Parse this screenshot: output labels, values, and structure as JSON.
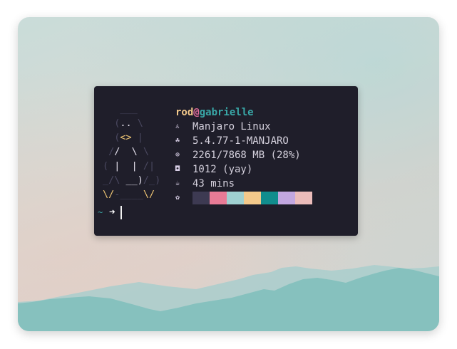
{
  "wallpaper": {
    "colors": {
      "sky_top": "#c9dcd9",
      "sky_warm": "#ddd2cc",
      "mountain_back": "#a9cecd",
      "mountain_front": "#86c1be"
    }
  },
  "terminal": {
    "background": "#1f1e2a",
    "ascii_logo": {
      "line0": "   ___",
      "line1a": "  (",
      "line1b": ".. ",
      "line1c": "\\",
      "line2a": "  (",
      "line2b": "<>",
      "line2c": " |",
      "line3a": " /",
      "line3b": "/  \\",
      "line3c": " \\",
      "line4a": "( ",
      "line4b": "|  |",
      "line4c": " /|",
      "line5a": "_/\\",
      "line5b": " __)",
      "line5c": "/_)",
      "line6a": "\\/",
      "line6b": "-____",
      "line6c": "\\/"
    },
    "fetch": {
      "user": "rod",
      "at": "@",
      "host": "gabrielle",
      "rows": [
        {
          "icon": "linux-penguin-icon",
          "glyph": "♙",
          "value": "Manjaro Linux"
        },
        {
          "icon": "kernel-icon",
          "glyph": "☘",
          "value": "5.4.77-1-MANJARO"
        },
        {
          "icon": "memory-icon",
          "glyph": "⊕",
          "value": "2261/7868 MB (28%)"
        },
        {
          "icon": "package-icon",
          "glyph": "◘",
          "value": "1012 (yay)"
        },
        {
          "icon": "uptime-coffee-icon",
          "glyph": "☕",
          "value": "43 mins"
        }
      ],
      "palette_icon": {
        "icon": "palette-icon",
        "glyph": "✿"
      },
      "palette": [
        "#3d3a52",
        "#e87b96",
        "#9fd1d1",
        "#f3c98b",
        "#118d8d",
        "#c2a7e0",
        "#ebbcba"
      ]
    },
    "prompt": {
      "dir": "~",
      "arrow": "➜"
    }
  }
}
